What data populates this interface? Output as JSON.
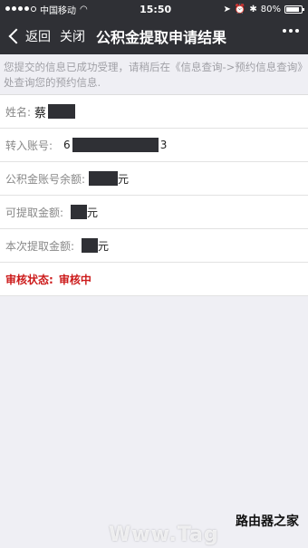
{
  "status_bar": {
    "carrier": "中国移动",
    "time": "15:50",
    "battery": "80%"
  },
  "nav": {
    "back_label": "返回",
    "close_label": "关闭",
    "title": "公积金提取申请结果"
  },
  "notice": "您提交的信息已成功受理，请稍后在《信息查询->预约信息查询》处查询您的预约信息.",
  "fields": [
    {
      "label": "姓名:",
      "value": "蔡"
    },
    {
      "label": "转入账号:",
      "value_prefix": "6",
      "value_suffix": "3"
    },
    {
      "label": "公积金账号余额:",
      "unit": "元"
    },
    {
      "label": "可提取金额:",
      "unit": "元"
    },
    {
      "label": "本次提取金额:",
      "unit": "元"
    }
  ],
  "review": {
    "label": "审核状态:",
    "value": "审核中"
  },
  "watermark": {
    "text": "Www.Tag",
    "logo": "路由器之家"
  },
  "colors": {
    "nav_bg": "#2f3035",
    "status_red": "#cc1a1a",
    "page_bg": "#efeff4"
  }
}
